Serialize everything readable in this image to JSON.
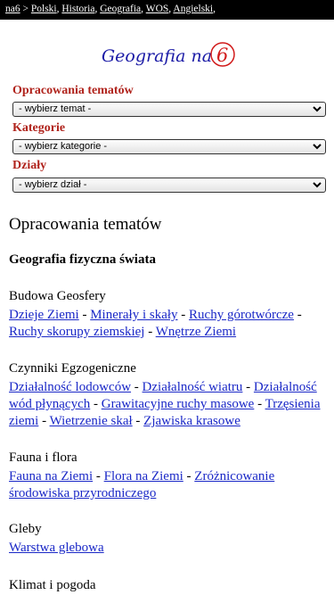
{
  "breadcrumb": {
    "home": "na6",
    "separator": " > ",
    "items": [
      "Polski",
      "Historia",
      "Geografia",
      "WOS",
      "Angielski"
    ]
  },
  "logo": {
    "text": "Geografia na",
    "number": "6"
  },
  "filters": [
    {
      "label": "Opracowania tematów",
      "selected": "- wybierz temat -"
    },
    {
      "label": "Kategorie",
      "selected": "- wybierz kategorie -"
    },
    {
      "label": "Działy",
      "selected": "- wybierz dział -"
    }
  ],
  "main": {
    "title": "Opracowania tematów",
    "subheading": "Geografia fizyczna świata",
    "categories": [
      {
        "title": "Budowa Geosfery",
        "links": [
          "Dzieje Ziemi",
          "Minerały i skały",
          "Ruchy górotwórcze",
          "Ruchy skorupy ziemskiej",
          "Wnętrze Ziemi"
        ]
      },
      {
        "title": "Czynniki Egzogeniczne",
        "links": [
          "Działalność lodowców",
          "Działalność wiatru",
          "Działalność wód płynących",
          "Grawitacyjne ruchy masowe",
          "Trzęsienia ziemi",
          "Wietrzenie skał",
          "Zjawiska krasowe"
        ]
      },
      {
        "title": "Fauna i flora",
        "links": [
          "Fauna na Ziemi",
          "Flora na Ziemi",
          "Zróżnicowanie środowiska przyrodniczego"
        ]
      },
      {
        "title": "Gleby",
        "links": [
          "Warstwa glebowa"
        ]
      },
      {
        "title": "Klimat i pogoda",
        "links": []
      }
    ]
  },
  "colors": {
    "filter_label": "#b0231c",
    "link": "#1a28c7",
    "logo_ink": "#1a1aa6",
    "logo_circle": "#d11a1a"
  }
}
